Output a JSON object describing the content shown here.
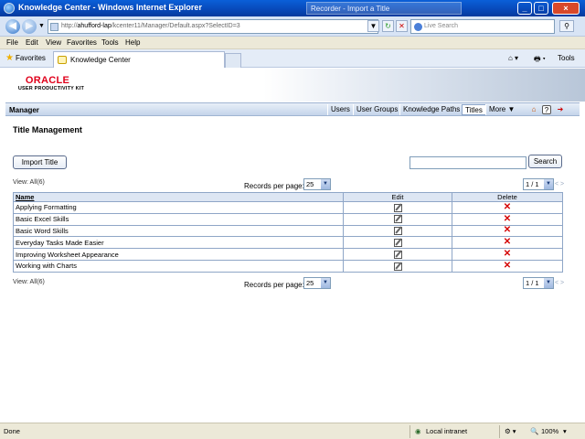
{
  "browser": {
    "window_title": "Knowledge Center - Windows Internet Explorer",
    "popup_title": "Recorder - Import a Title",
    "address": {
      "prefix": "http://",
      "host": "ahufford-lap",
      "path": "/kcenter11/Manager/Default.aspx?SelectID=3"
    },
    "search_placeholder": "Live Search",
    "menu": [
      "File",
      "Edit",
      "View",
      "Favorites",
      "Tools",
      "Help"
    ],
    "favorites_label": "Favorites",
    "tab_label": "Knowledge Center",
    "tools_label": "Tools",
    "status": {
      "left": "Done",
      "zone": "Local intranet",
      "zoom": "100%"
    }
  },
  "branding": {
    "logo_name": "ORACLE",
    "logo_sub": "USER PRODUCTIVITY KIT"
  },
  "nav": {
    "section": "Manager",
    "links": [
      "Users",
      "User Groups",
      "Knowledge Paths",
      "Titles",
      "More"
    ],
    "active": "Titles"
  },
  "page": {
    "title": "Title Management",
    "import_button": "Import Title",
    "search_button": "Search",
    "search_value": "",
    "view_all": "View: All(6)",
    "records_per_page_label": "Records per page:",
    "records_per_page": "25",
    "page_indicator": "1 / 1",
    "page_arrows": "< >"
  },
  "table": {
    "columns": [
      "Name",
      "Edit",
      "Delete"
    ],
    "rows": [
      {
        "name": "Applying Formatting"
      },
      {
        "name": "Basic Excel Skills"
      },
      {
        "name": "Basic Word Skills"
      },
      {
        "name": "Everyday Tasks Made Easier"
      },
      {
        "name": "Improving Worksheet Appearance"
      },
      {
        "name": "Working with Charts"
      }
    ]
  },
  "colors": {
    "oracle_red": "#e0001b",
    "delete_red": "#d40000",
    "nav_blue": "#c4d4ea"
  }
}
